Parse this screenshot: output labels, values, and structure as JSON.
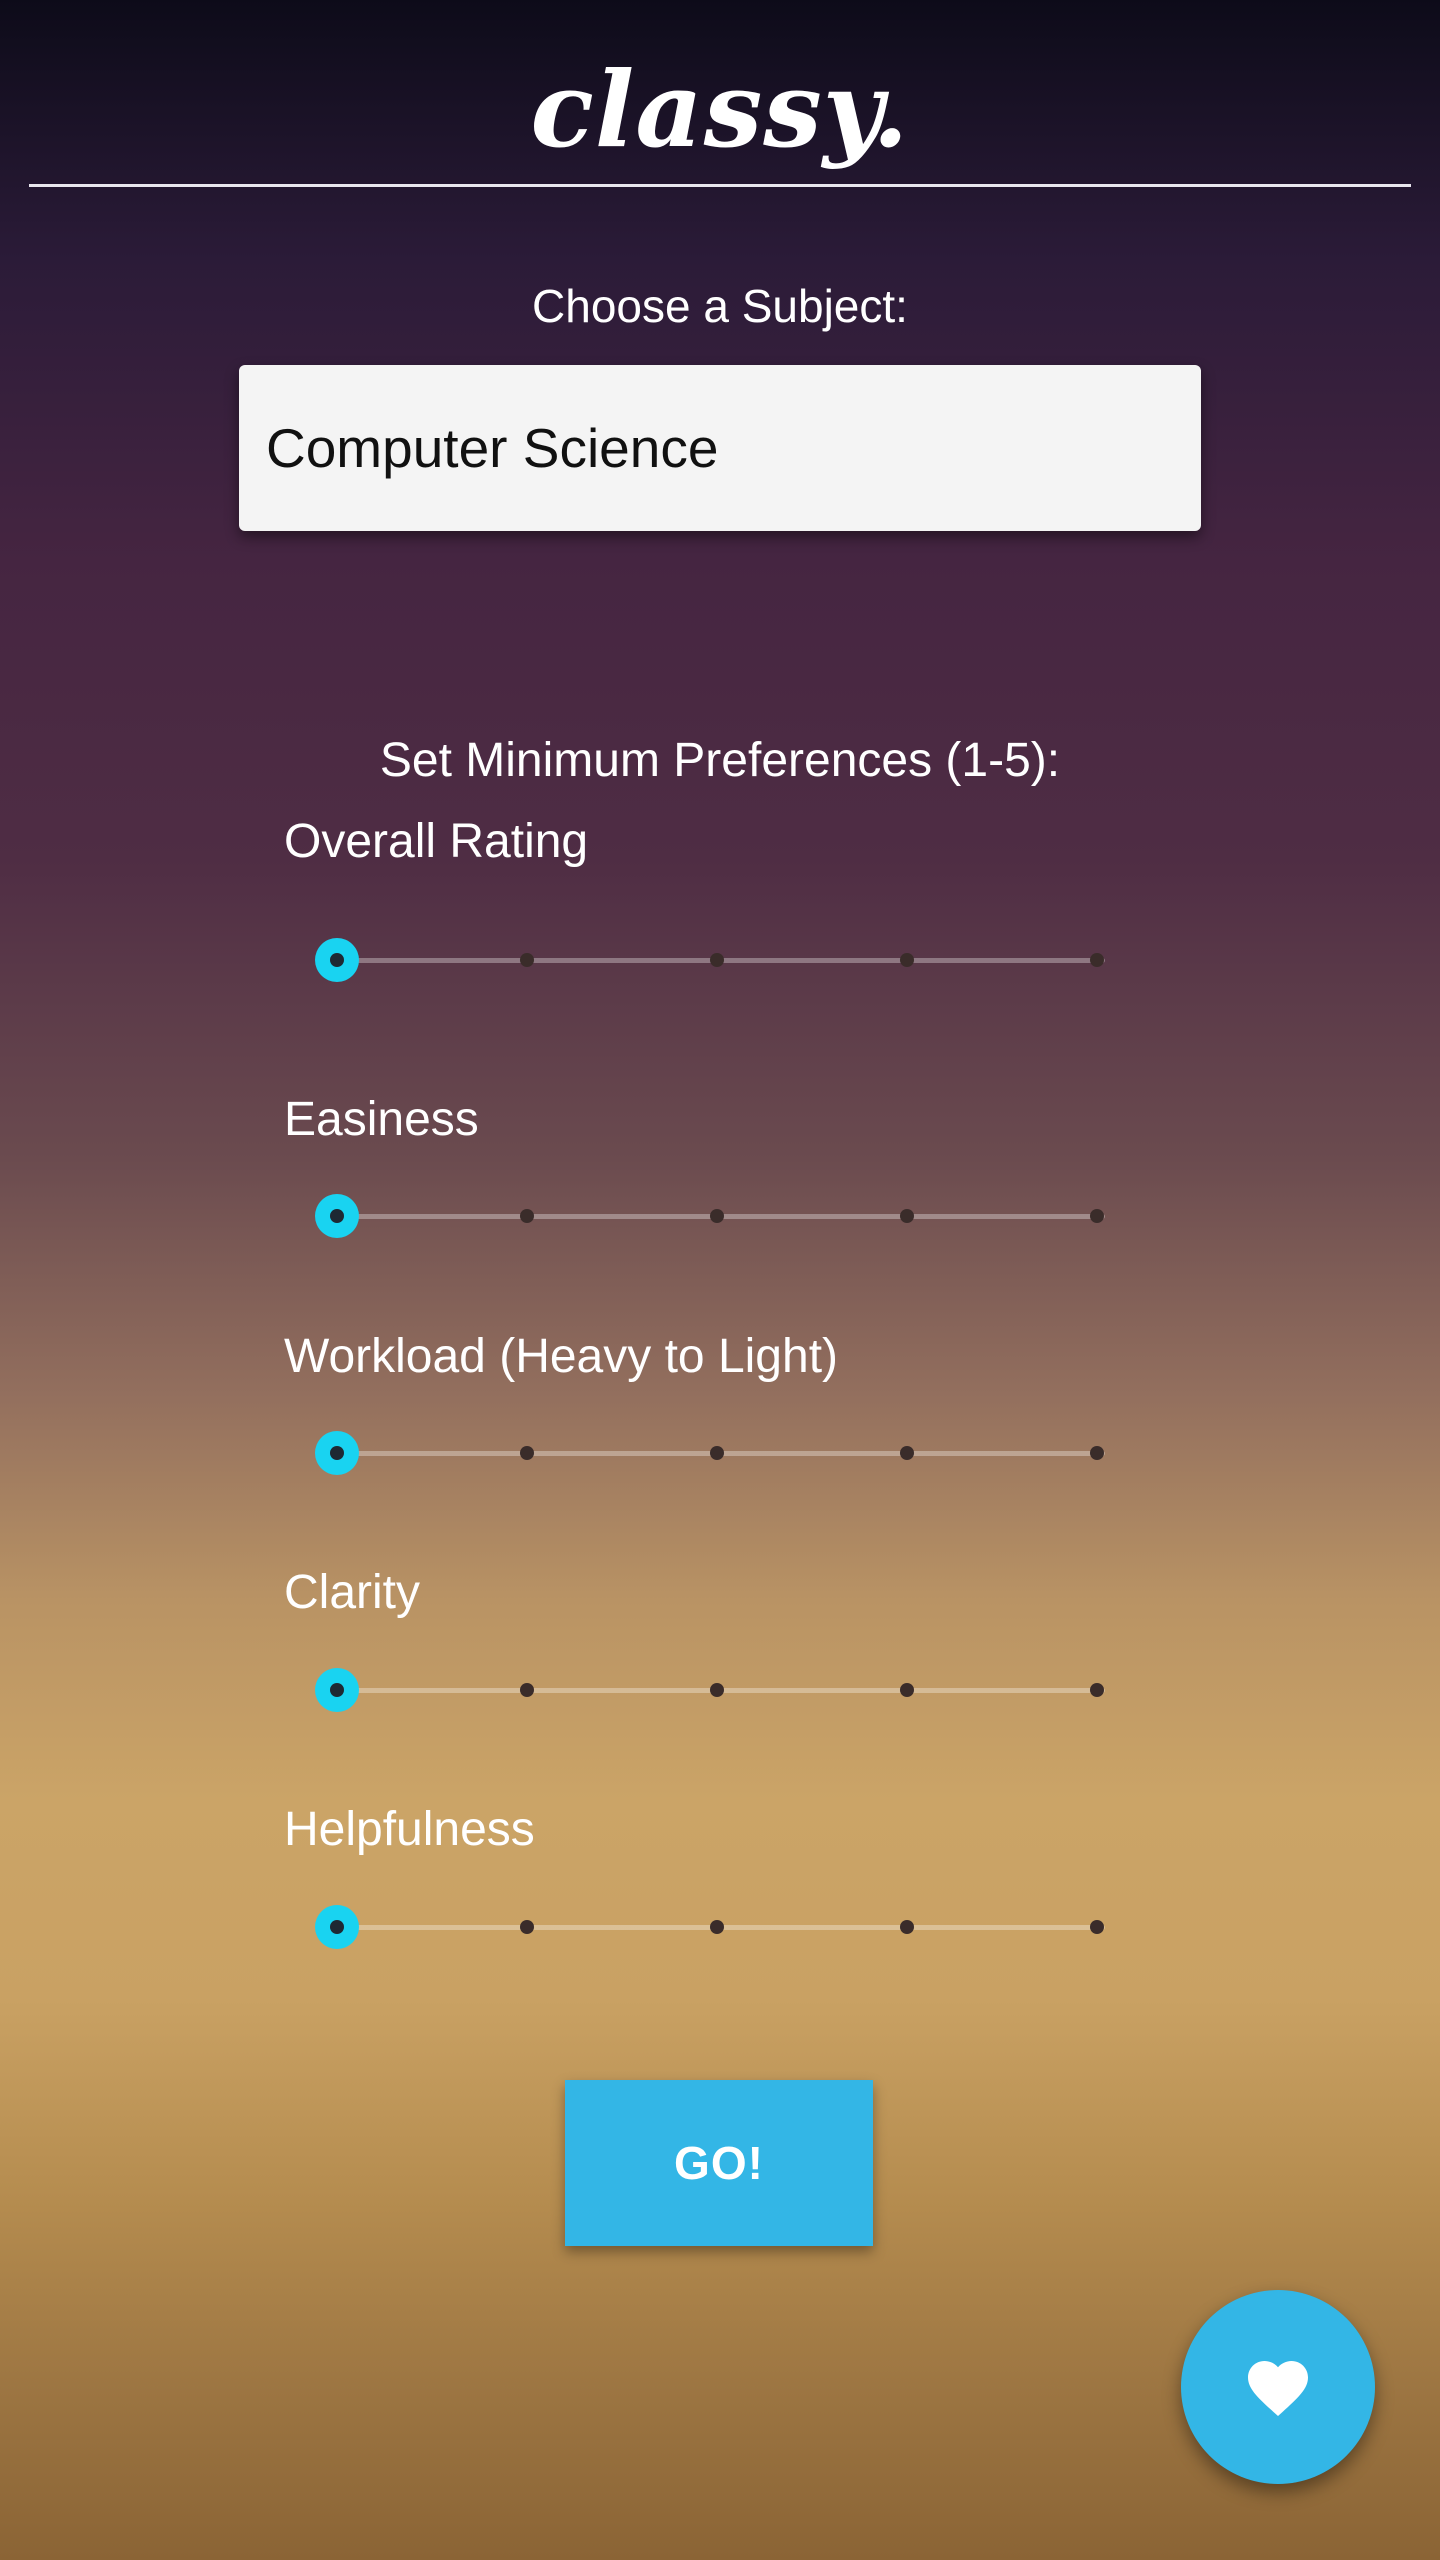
{
  "app": {
    "logo": "classy."
  },
  "subject": {
    "label": "Choose a Subject:",
    "selected": "Computer Science"
  },
  "preferences": {
    "heading": "Set Minimum Preferences (1-5):",
    "scale": {
      "min": 1,
      "max": 5
    },
    "items": [
      {
        "label": "Overall Rating",
        "value": 1
      },
      {
        "label": "Easiness",
        "value": 1
      },
      {
        "label": "Workload (Heavy to Light)",
        "value": 1
      },
      {
        "label": "Clarity",
        "value": 1
      },
      {
        "label": "Helpfulness",
        "value": 1
      }
    ]
  },
  "actions": {
    "go_label": "GO!",
    "favorite_icon": "heart-icon"
  },
  "colors": {
    "accent": "#33b6e6",
    "slider_thumb": "#19d3f1"
  }
}
